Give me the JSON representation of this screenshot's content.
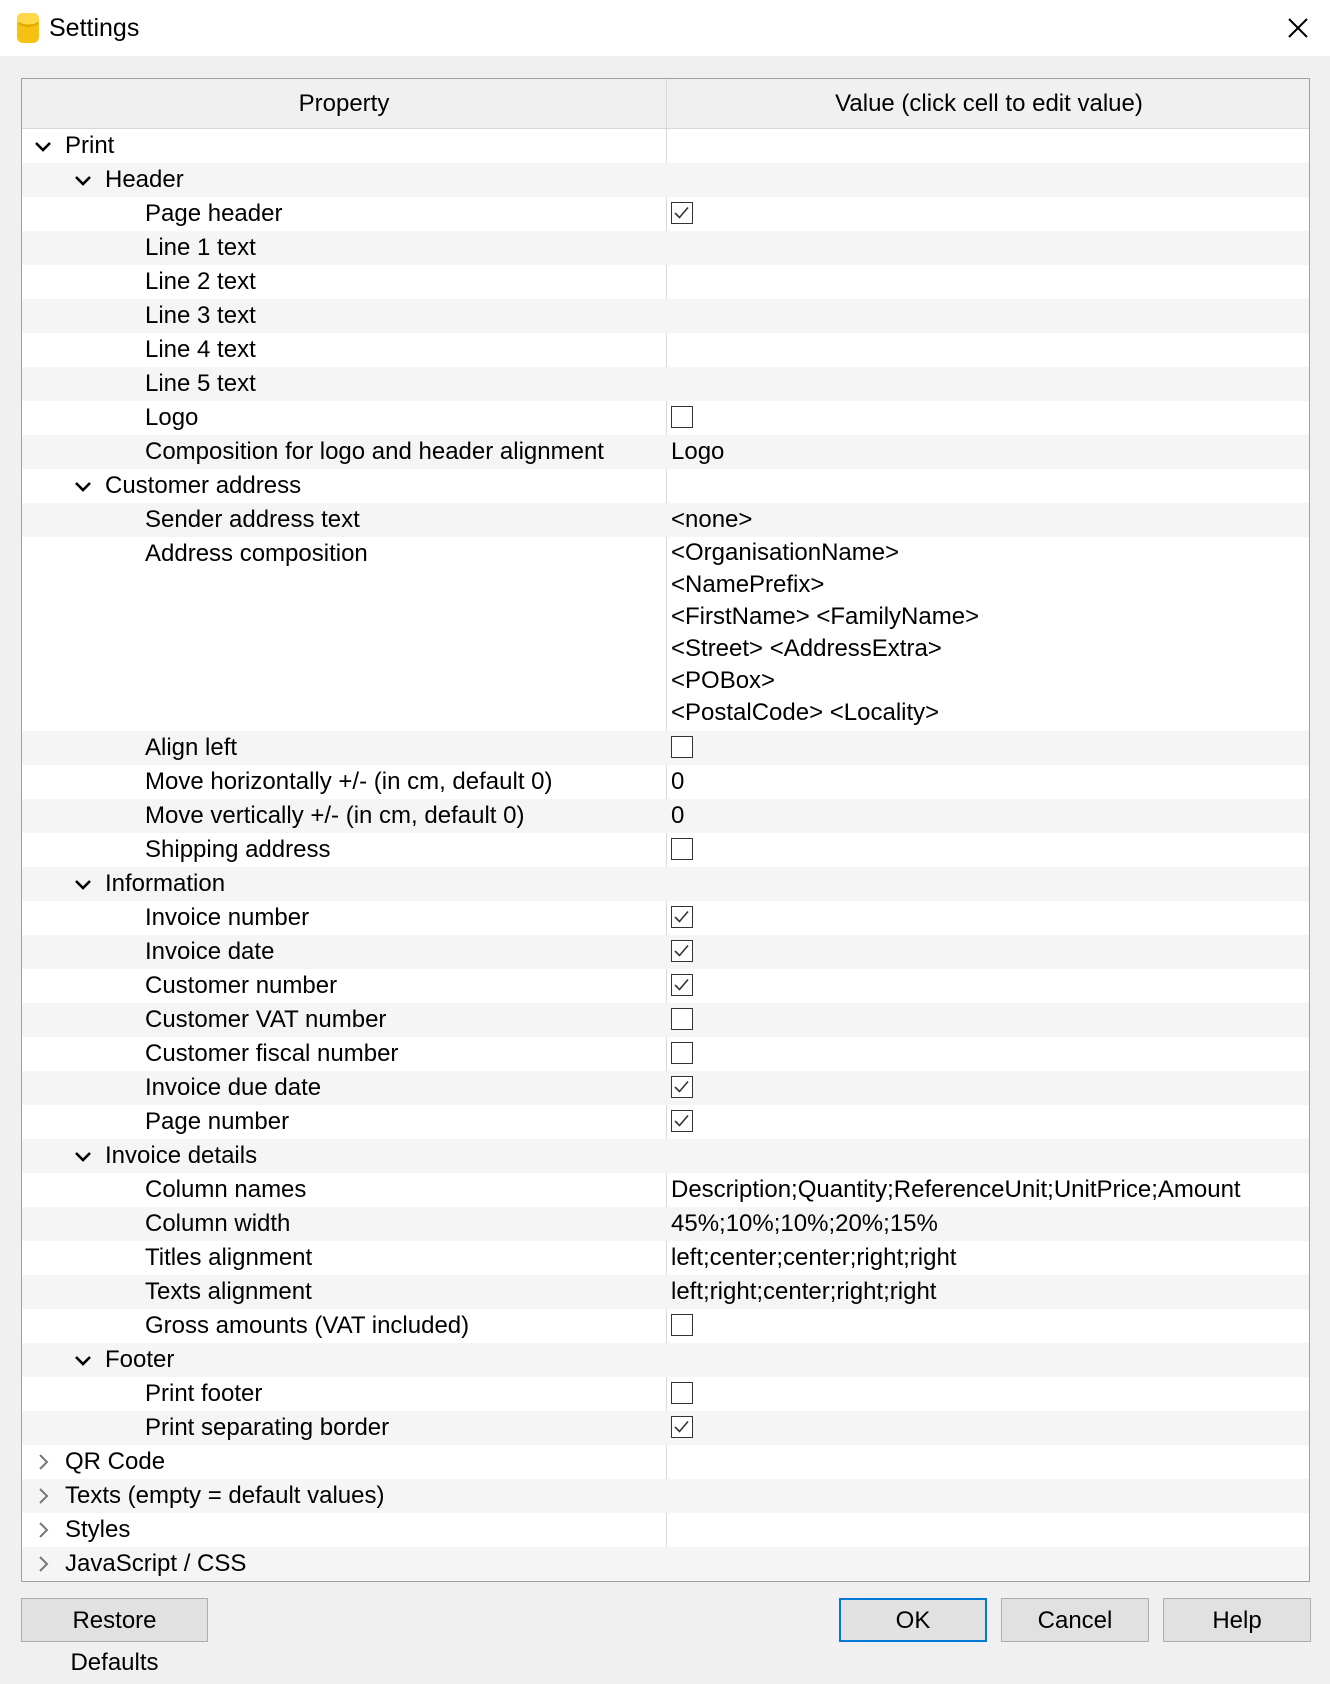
{
  "window": {
    "title": "Settings",
    "icons": {
      "app": "app-logo-icon",
      "close": "close-icon"
    }
  },
  "columns": {
    "property": "Property",
    "value": "Value (click cell to edit value)"
  },
  "rows": [
    {
      "label": "Print",
      "level": 0,
      "expander": "expanded",
      "type": "group"
    },
    {
      "label": "Header",
      "level": 1,
      "expander": "expanded",
      "type": "group"
    },
    {
      "label": "Page header",
      "level": 2,
      "type": "checkbox",
      "checked": true
    },
    {
      "label": "Line 1 text",
      "level": 2,
      "type": "text",
      "value": ""
    },
    {
      "label": "Line 2 text",
      "level": 2,
      "type": "text",
      "value": ""
    },
    {
      "label": "Line 3 text",
      "level": 2,
      "type": "text",
      "value": ""
    },
    {
      "label": "Line 4 text",
      "level": 2,
      "type": "text",
      "value": ""
    },
    {
      "label": "Line 5 text",
      "level": 2,
      "type": "text",
      "value": ""
    },
    {
      "label": "Logo",
      "level": 2,
      "type": "checkbox",
      "checked": false
    },
    {
      "label": "Composition for logo and header alignment",
      "level": 2,
      "type": "text",
      "value": "Logo"
    },
    {
      "label": "Customer address",
      "level": 1,
      "expander": "expanded",
      "type": "group"
    },
    {
      "label": "Sender address text",
      "level": 2,
      "type": "text",
      "value": "<none>"
    },
    {
      "label": "Address composition",
      "level": 2,
      "type": "multiline",
      "lines": [
        "<OrganisationName>",
        "<NamePrefix>",
        "<FirstName> <FamilyName>",
        "<Street> <AddressExtra>",
        "<POBox>",
        "<PostalCode> <Locality>"
      ]
    },
    {
      "label": "Align left",
      "level": 2,
      "type": "checkbox",
      "checked": false
    },
    {
      "label": "Move horizontally +/- (in cm, default 0)",
      "level": 2,
      "type": "text",
      "value": "0"
    },
    {
      "label": "Move vertically +/- (in cm, default 0)",
      "level": 2,
      "type": "text",
      "value": "0"
    },
    {
      "label": "Shipping address",
      "level": 2,
      "type": "checkbox",
      "checked": false
    },
    {
      "label": "Information",
      "level": 1,
      "expander": "expanded",
      "type": "group"
    },
    {
      "label": "Invoice number",
      "level": 2,
      "type": "checkbox",
      "checked": true
    },
    {
      "label": "Invoice date",
      "level": 2,
      "type": "checkbox",
      "checked": true
    },
    {
      "label": "Customer number",
      "level": 2,
      "type": "checkbox",
      "checked": true
    },
    {
      "label": "Customer VAT number",
      "level": 2,
      "type": "checkbox",
      "checked": false
    },
    {
      "label": "Customer fiscal number",
      "level": 2,
      "type": "checkbox",
      "checked": false
    },
    {
      "label": "Invoice due date",
      "level": 2,
      "type": "checkbox",
      "checked": true
    },
    {
      "label": "Page number",
      "level": 2,
      "type": "checkbox",
      "checked": true
    },
    {
      "label": "Invoice details",
      "level": 1,
      "expander": "expanded",
      "type": "group"
    },
    {
      "label": "Column names",
      "level": 2,
      "type": "text",
      "value": "Description;Quantity;ReferenceUnit;UnitPrice;Amount"
    },
    {
      "label": "Column width",
      "level": 2,
      "type": "text",
      "value": "45%;10%;10%;20%;15%"
    },
    {
      "label": "Titles alignment",
      "level": 2,
      "type": "text",
      "value": "left;center;center;right;right"
    },
    {
      "label": "Texts alignment",
      "level": 2,
      "type": "text",
      "value": "left;right;center;right;right"
    },
    {
      "label": "Gross amounts (VAT included)",
      "level": 2,
      "type": "checkbox",
      "checked": false
    },
    {
      "label": "Footer",
      "level": 1,
      "expander": "expanded",
      "type": "group"
    },
    {
      "label": "Print footer",
      "level": 2,
      "type": "checkbox",
      "checked": false
    },
    {
      "label": "Print separating border",
      "level": 2,
      "type": "checkbox",
      "checked": true
    },
    {
      "label": "QR Code",
      "level": 0,
      "expander": "collapsed",
      "type": "group"
    },
    {
      "label": "Texts (empty = default values)",
      "level": 0,
      "expander": "collapsed",
      "type": "group"
    },
    {
      "label": "Styles",
      "level": 0,
      "expander": "collapsed",
      "type": "group"
    },
    {
      "label": "JavaScript / CSS",
      "level": 0,
      "expander": "collapsed",
      "type": "group"
    }
  ],
  "buttons": {
    "restore_defaults": "Restore Defaults",
    "ok": "OK",
    "cancel": "Cancel",
    "help": "Help"
  },
  "colors": {
    "app_icon": "#f5c211",
    "ok_border": "#0078d7",
    "row_alt": "#f5f5f5"
  }
}
